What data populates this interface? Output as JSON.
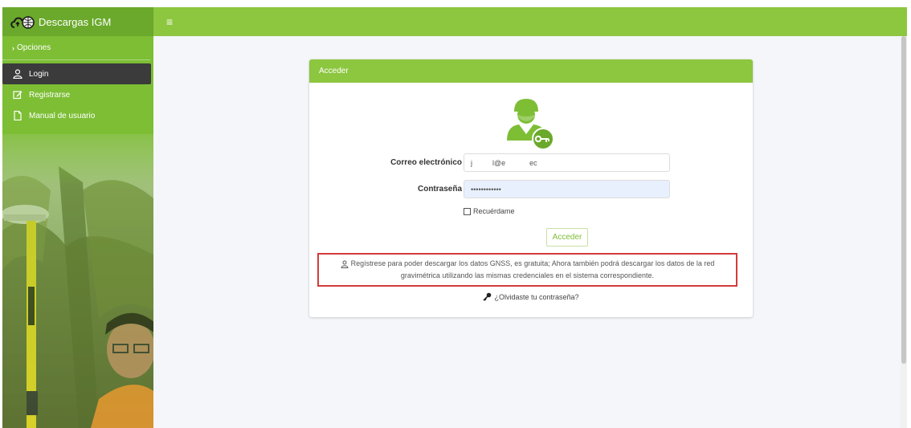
{
  "app": {
    "title": "Descargas IGM",
    "colors": {
      "sidebar": "#7dbe35",
      "topbar": "#8dc63f",
      "active_item": "#3b3b3b",
      "notice_border": "#d33b3b"
    }
  },
  "sidebar": {
    "section_label": "Opciones",
    "items": [
      {
        "label": "Login",
        "icon": "user-icon",
        "active": true
      },
      {
        "label": "Registrarse",
        "icon": "edit-icon",
        "active": false
      },
      {
        "label": "Manual de usuario",
        "icon": "document-icon",
        "active": false
      }
    ]
  },
  "topbar": {
    "menu_icon": "hamburger-icon"
  },
  "login_card": {
    "header": "Acceder",
    "email_label": "Correo electrónico",
    "email_value": "j          l@e            ec",
    "password_label": "Contraseña",
    "password_value": "••••••••••••",
    "remember_label": "Recuérdame",
    "submit_label": "Acceder",
    "notice_line1": "Regístrese para poder descargar los datos GNSS, es gratuita; Ahora también podrá descargar los datos de la red",
    "notice_line2": "gravimétrica utilizando las mismas credenciales en el sistema correspondiente.",
    "forgot_label": "¿Olvidaste tu contraseña?"
  }
}
